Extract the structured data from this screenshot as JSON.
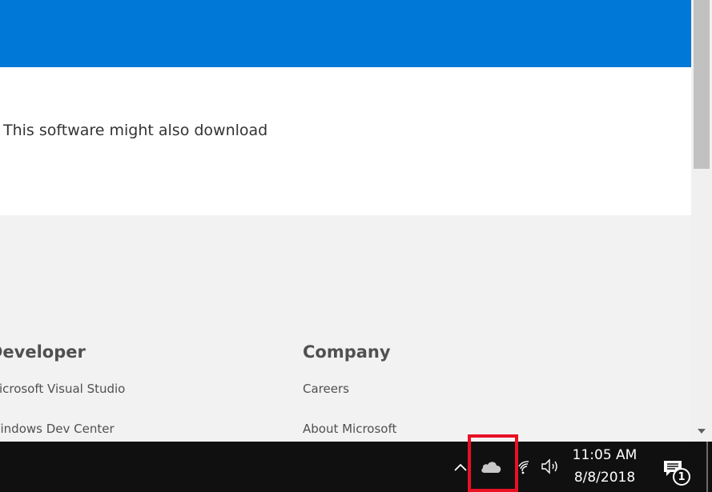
{
  "page": {
    "content_text": "This software might also download",
    "footer": {
      "developer": {
        "heading": "Developer",
        "links": [
          "Microsoft Visual Studio",
          "Windows Dev Center"
        ]
      },
      "company": {
        "heading": "Company",
        "links": [
          "Careers",
          "About Microsoft"
        ]
      }
    }
  },
  "colors": {
    "banner": "#0078d7",
    "highlight": "#e81123",
    "taskbar": "#101010"
  },
  "taskbar": {
    "icons": [
      "chevron-up-icon",
      "onedrive-cloud-icon",
      "wifi-icon",
      "volume-icon",
      "action-center-icon"
    ],
    "time": "11:05 AM",
    "date": "8/8/2018",
    "notification_count": "1"
  }
}
